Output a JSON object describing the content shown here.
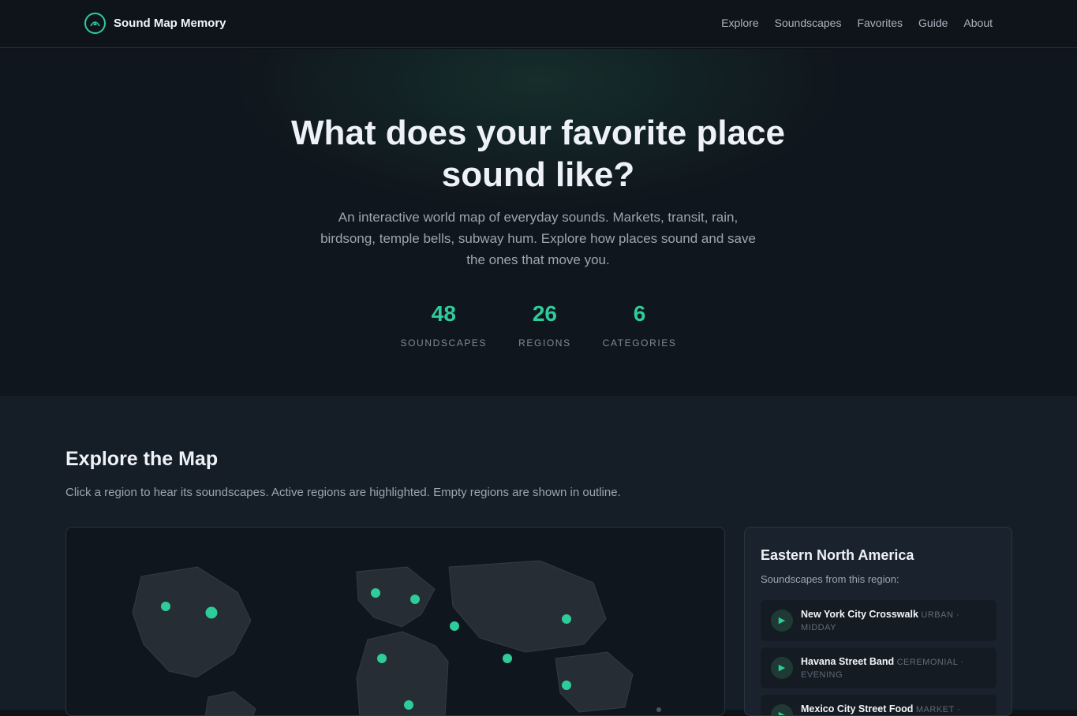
{
  "brand": {
    "name": "Sound Map Memory",
    "icon": "sound-wave-icon"
  },
  "nav": {
    "links": [
      "Explore",
      "Soundscapes",
      "Favorites",
      "Guide",
      "About"
    ]
  },
  "hero": {
    "title": "What does your favorite place sound like?",
    "subtitle": "An interactive world map of everyday sounds. Markets, transit, rain, birdsong, temple bells, subway hum. Explore how places sound and save the ones that move you.",
    "stats": [
      {
        "value": "48",
        "label": "SOUNDSCAPES"
      },
      {
        "value": "26",
        "label": "REGIONS"
      },
      {
        "value": "6",
        "label": "CATEGORIES"
      }
    ]
  },
  "explore": {
    "title": "Explore the Map",
    "description": "Click a region to hear its soundscapes. Active regions are highlighted. Empty regions are shown in outline."
  },
  "panel": {
    "title": "Eastern North America",
    "subtitle": "Soundscapes from this region:",
    "items": [
      {
        "name": "New York City Crosswalk",
        "category": "URBAN",
        "time": "MIDDAY"
      },
      {
        "name": "Havana Street Band",
        "category": "CEREMONIAL",
        "time": "EVENING"
      },
      {
        "name": "Mexico City Street Food",
        "category": "MARKET",
        "time": ""
      }
    ]
  },
  "colors": {
    "accent": "#2ecc9a",
    "background": "#0f141b",
    "section": "#151d26"
  }
}
